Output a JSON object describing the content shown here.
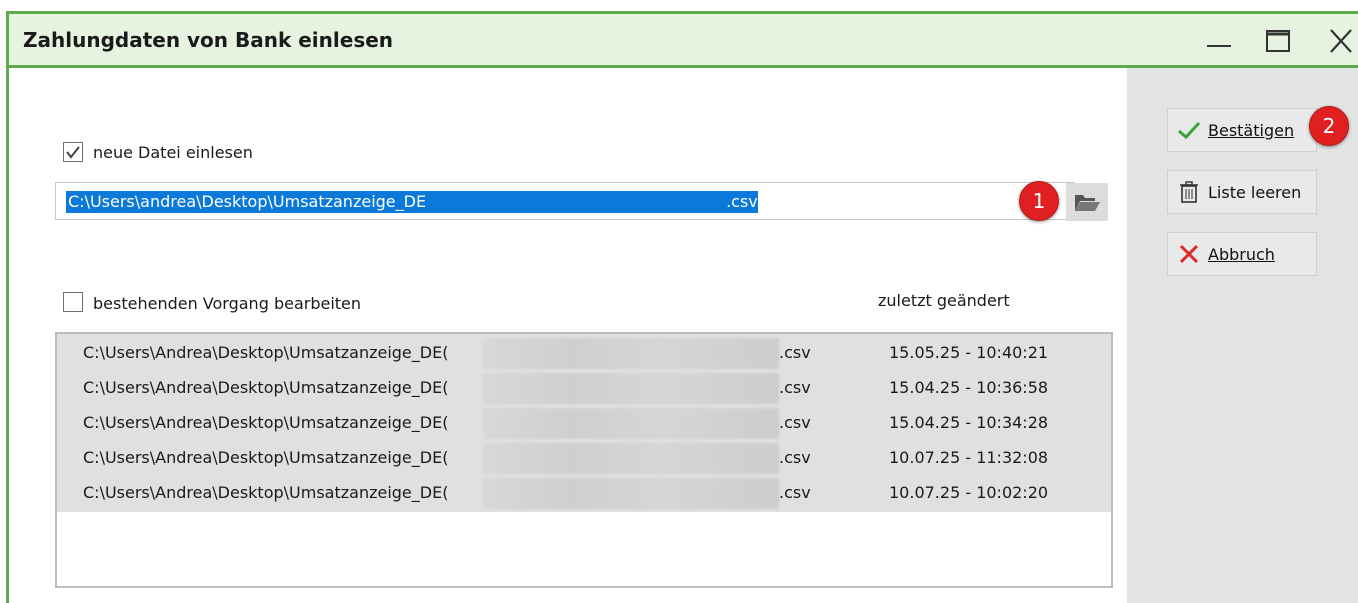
{
  "window": {
    "title": "Zahlungdaten von Bank einlesen"
  },
  "new_file": {
    "checked": true,
    "label": "neue Datei einlesen",
    "path_prefix": "C:\\Users\\andrea\\Desktop\\Umsatzanzeige_DE",
    "path_suffix": ".csv"
  },
  "existing": {
    "checked": false,
    "label": "bestehenden Vorgang bearbeiten",
    "date_header": "zuletzt geändert"
  },
  "files": [
    {
      "prefix": "C:\\Users\\Andrea\\Desktop\\Umsatzanzeige_DE(",
      "suffix": ".csv",
      "date": "15.05.25 - 10:40:21"
    },
    {
      "prefix": "C:\\Users\\Andrea\\Desktop\\Umsatzanzeige_DE(",
      "suffix": ".csv",
      "date": "15.04.25 - 10:36:58"
    },
    {
      "prefix": "C:\\Users\\Andrea\\Desktop\\Umsatzanzeige_DE(",
      "suffix": ".csv",
      "date": "15.04.25 - 10:34:28"
    },
    {
      "prefix": "C:\\Users\\Andrea\\Desktop\\Umsatzanzeige_DE(",
      "suffix": ".csv",
      "date": "10.07.25 - 11:32:08"
    },
    {
      "prefix": "C:\\Users\\Andrea\\Desktop\\Umsatzanzeige_DE(",
      "suffix": ".csv",
      "date": "10.07.25 - 10:02:20"
    }
  ],
  "buttons": {
    "confirm": "Bestätigen",
    "clear": "Liste leeren",
    "cancel": "Abbruch"
  },
  "badges": {
    "one": "1",
    "two": "2"
  },
  "icons": {
    "folder": "folder-open-icon",
    "check": "checkmark-icon",
    "trash": "trash-icon",
    "cross": "cross-icon"
  },
  "colors": {
    "accent_green": "#5faa4c",
    "selection_blue": "#0a79d9",
    "badge_red": "#e02020"
  }
}
